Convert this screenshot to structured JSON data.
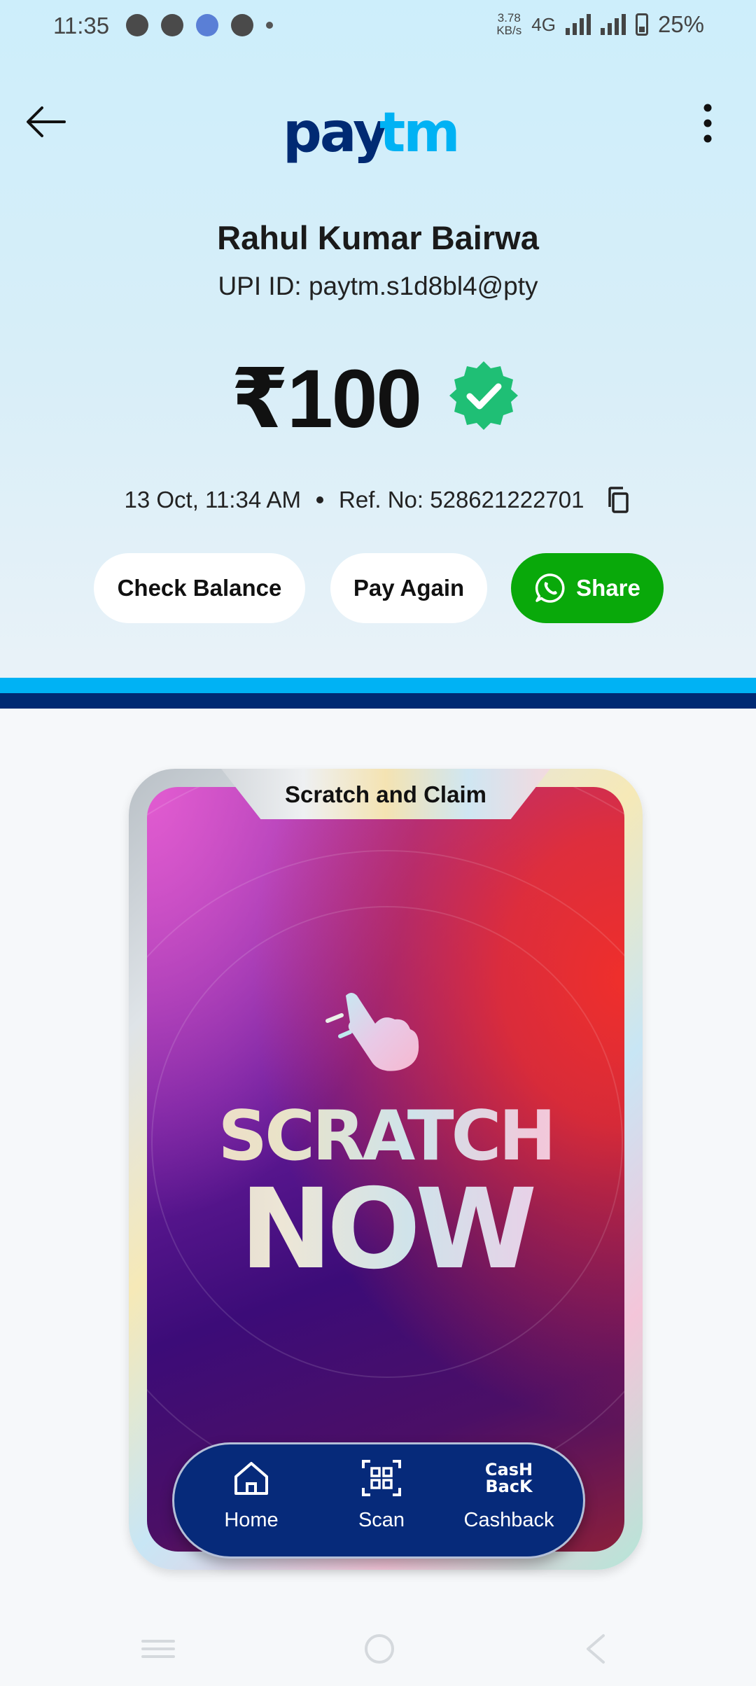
{
  "status_bar": {
    "time": "11:35",
    "net_speed_value": "3.78",
    "net_speed_unit": "KB/s",
    "network": "4G",
    "battery": "25%"
  },
  "header": {
    "logo_text_pay": "pay",
    "logo_text_tm": "tm"
  },
  "payment": {
    "payee_name": "Rahul Kumar Bairwa",
    "upi_id": "UPI ID: paytm.s1d8bl4@pty",
    "amount": "₹100",
    "date_time": "13 Oct, 11:34 AM",
    "reference": "Ref. No: 528621222701"
  },
  "actions": {
    "check_balance": "Check Balance",
    "pay_again": "Pay Again",
    "share": "Share"
  },
  "scratch_card": {
    "title": "Scratch and Claim",
    "line1": "SCRATCH",
    "line2": "NOW"
  },
  "bottom_nav": {
    "home": "Home",
    "scan": "Scan",
    "cashback": "Cashback",
    "cashback_logo_top": "CasH",
    "cashback_logo_bottom": "BacK"
  },
  "colors": {
    "brand_dark": "#002a73",
    "brand_light": "#00b2f4",
    "success": "#1fbf75",
    "whatsapp": "#09a90a"
  }
}
